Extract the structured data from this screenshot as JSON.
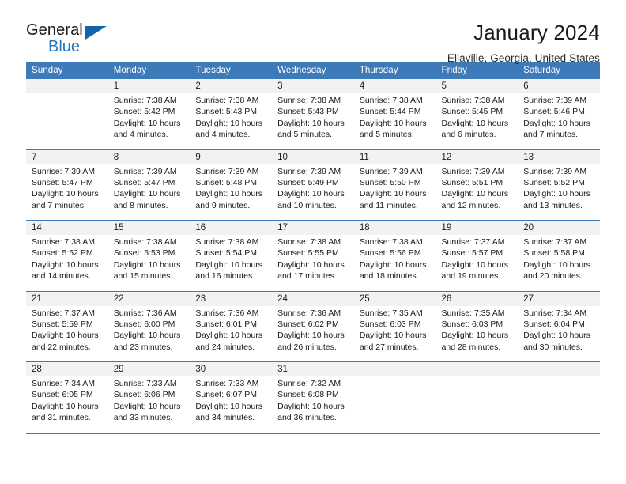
{
  "brand": {
    "name_part1": "General",
    "name_part2": "Blue",
    "triangle_icon": "triangle-icon",
    "color_black": "#1b1b1b",
    "color_blue": "#1f7ac0"
  },
  "header": {
    "title": "January 2024",
    "subtitle": "Ellaville, Georgia, United States"
  },
  "theme": {
    "header_blue": "#3d7ab9",
    "daynum_gray": "#f2f2f2",
    "text": "#1b1b1b"
  },
  "weekday_headers": [
    "Sunday",
    "Monday",
    "Tuesday",
    "Wednesday",
    "Thursday",
    "Friday",
    "Saturday"
  ],
  "weeks": [
    [
      {
        "day": "",
        "sunrise": "",
        "sunset": "",
        "daylight_1": "",
        "daylight_2": "",
        "empty": true
      },
      {
        "day": "1",
        "sunrise": "Sunrise: 7:38 AM",
        "sunset": "Sunset: 5:42 PM",
        "daylight_1": "Daylight: 10 hours",
        "daylight_2": "and 4 minutes."
      },
      {
        "day": "2",
        "sunrise": "Sunrise: 7:38 AM",
        "sunset": "Sunset: 5:43 PM",
        "daylight_1": "Daylight: 10 hours",
        "daylight_2": "and 4 minutes."
      },
      {
        "day": "3",
        "sunrise": "Sunrise: 7:38 AM",
        "sunset": "Sunset: 5:43 PM",
        "daylight_1": "Daylight: 10 hours",
        "daylight_2": "and 5 minutes."
      },
      {
        "day": "4",
        "sunrise": "Sunrise: 7:38 AM",
        "sunset": "Sunset: 5:44 PM",
        "daylight_1": "Daylight: 10 hours",
        "daylight_2": "and 5 minutes."
      },
      {
        "day": "5",
        "sunrise": "Sunrise: 7:38 AM",
        "sunset": "Sunset: 5:45 PM",
        "daylight_1": "Daylight: 10 hours",
        "daylight_2": "and 6 minutes."
      },
      {
        "day": "6",
        "sunrise": "Sunrise: 7:39 AM",
        "sunset": "Sunset: 5:46 PM",
        "daylight_1": "Daylight: 10 hours",
        "daylight_2": "and 7 minutes."
      }
    ],
    [
      {
        "day": "7",
        "sunrise": "Sunrise: 7:39 AM",
        "sunset": "Sunset: 5:47 PM",
        "daylight_1": "Daylight: 10 hours",
        "daylight_2": "and 7 minutes."
      },
      {
        "day": "8",
        "sunrise": "Sunrise: 7:39 AM",
        "sunset": "Sunset: 5:47 PM",
        "daylight_1": "Daylight: 10 hours",
        "daylight_2": "and 8 minutes."
      },
      {
        "day": "9",
        "sunrise": "Sunrise: 7:39 AM",
        "sunset": "Sunset: 5:48 PM",
        "daylight_1": "Daylight: 10 hours",
        "daylight_2": "and 9 minutes."
      },
      {
        "day": "10",
        "sunrise": "Sunrise: 7:39 AM",
        "sunset": "Sunset: 5:49 PM",
        "daylight_1": "Daylight: 10 hours",
        "daylight_2": "and 10 minutes."
      },
      {
        "day": "11",
        "sunrise": "Sunrise: 7:39 AM",
        "sunset": "Sunset: 5:50 PM",
        "daylight_1": "Daylight: 10 hours",
        "daylight_2": "and 11 minutes."
      },
      {
        "day": "12",
        "sunrise": "Sunrise: 7:39 AM",
        "sunset": "Sunset: 5:51 PM",
        "daylight_1": "Daylight: 10 hours",
        "daylight_2": "and 12 minutes."
      },
      {
        "day": "13",
        "sunrise": "Sunrise: 7:39 AM",
        "sunset": "Sunset: 5:52 PM",
        "daylight_1": "Daylight: 10 hours",
        "daylight_2": "and 13 minutes."
      }
    ],
    [
      {
        "day": "14",
        "sunrise": "Sunrise: 7:38 AM",
        "sunset": "Sunset: 5:52 PM",
        "daylight_1": "Daylight: 10 hours",
        "daylight_2": "and 14 minutes."
      },
      {
        "day": "15",
        "sunrise": "Sunrise: 7:38 AM",
        "sunset": "Sunset: 5:53 PM",
        "daylight_1": "Daylight: 10 hours",
        "daylight_2": "and 15 minutes."
      },
      {
        "day": "16",
        "sunrise": "Sunrise: 7:38 AM",
        "sunset": "Sunset: 5:54 PM",
        "daylight_1": "Daylight: 10 hours",
        "daylight_2": "and 16 minutes."
      },
      {
        "day": "17",
        "sunrise": "Sunrise: 7:38 AM",
        "sunset": "Sunset: 5:55 PM",
        "daylight_1": "Daylight: 10 hours",
        "daylight_2": "and 17 minutes."
      },
      {
        "day": "18",
        "sunrise": "Sunrise: 7:38 AM",
        "sunset": "Sunset: 5:56 PM",
        "daylight_1": "Daylight: 10 hours",
        "daylight_2": "and 18 minutes."
      },
      {
        "day": "19",
        "sunrise": "Sunrise: 7:37 AM",
        "sunset": "Sunset: 5:57 PM",
        "daylight_1": "Daylight: 10 hours",
        "daylight_2": "and 19 minutes."
      },
      {
        "day": "20",
        "sunrise": "Sunrise: 7:37 AM",
        "sunset": "Sunset: 5:58 PM",
        "daylight_1": "Daylight: 10 hours",
        "daylight_2": "and 20 minutes."
      }
    ],
    [
      {
        "day": "21",
        "sunrise": "Sunrise: 7:37 AM",
        "sunset": "Sunset: 5:59 PM",
        "daylight_1": "Daylight: 10 hours",
        "daylight_2": "and 22 minutes."
      },
      {
        "day": "22",
        "sunrise": "Sunrise: 7:36 AM",
        "sunset": "Sunset: 6:00 PM",
        "daylight_1": "Daylight: 10 hours",
        "daylight_2": "and 23 minutes."
      },
      {
        "day": "23",
        "sunrise": "Sunrise: 7:36 AM",
        "sunset": "Sunset: 6:01 PM",
        "daylight_1": "Daylight: 10 hours",
        "daylight_2": "and 24 minutes."
      },
      {
        "day": "24",
        "sunrise": "Sunrise: 7:36 AM",
        "sunset": "Sunset: 6:02 PM",
        "daylight_1": "Daylight: 10 hours",
        "daylight_2": "and 26 minutes."
      },
      {
        "day": "25",
        "sunrise": "Sunrise: 7:35 AM",
        "sunset": "Sunset: 6:03 PM",
        "daylight_1": "Daylight: 10 hours",
        "daylight_2": "and 27 minutes."
      },
      {
        "day": "26",
        "sunrise": "Sunrise: 7:35 AM",
        "sunset": "Sunset: 6:03 PM",
        "daylight_1": "Daylight: 10 hours",
        "daylight_2": "and 28 minutes."
      },
      {
        "day": "27",
        "sunrise": "Sunrise: 7:34 AM",
        "sunset": "Sunset: 6:04 PM",
        "daylight_1": "Daylight: 10 hours",
        "daylight_2": "and 30 minutes."
      }
    ],
    [
      {
        "day": "28",
        "sunrise": "Sunrise: 7:34 AM",
        "sunset": "Sunset: 6:05 PM",
        "daylight_1": "Daylight: 10 hours",
        "daylight_2": "and 31 minutes."
      },
      {
        "day": "29",
        "sunrise": "Sunrise: 7:33 AM",
        "sunset": "Sunset: 6:06 PM",
        "daylight_1": "Daylight: 10 hours",
        "daylight_2": "and 33 minutes."
      },
      {
        "day": "30",
        "sunrise": "Sunrise: 7:33 AM",
        "sunset": "Sunset: 6:07 PM",
        "daylight_1": "Daylight: 10 hours",
        "daylight_2": "and 34 minutes."
      },
      {
        "day": "31",
        "sunrise": "Sunrise: 7:32 AM",
        "sunset": "Sunset: 6:08 PM",
        "daylight_1": "Daylight: 10 hours",
        "daylight_2": "and 36 minutes."
      },
      {
        "day": "",
        "sunrise": "",
        "sunset": "",
        "daylight_1": "",
        "daylight_2": "",
        "empty": true
      },
      {
        "day": "",
        "sunrise": "",
        "sunset": "",
        "daylight_1": "",
        "daylight_2": "",
        "empty": true
      },
      {
        "day": "",
        "sunrise": "",
        "sunset": "",
        "daylight_1": "",
        "daylight_2": "",
        "empty": true
      }
    ]
  ]
}
